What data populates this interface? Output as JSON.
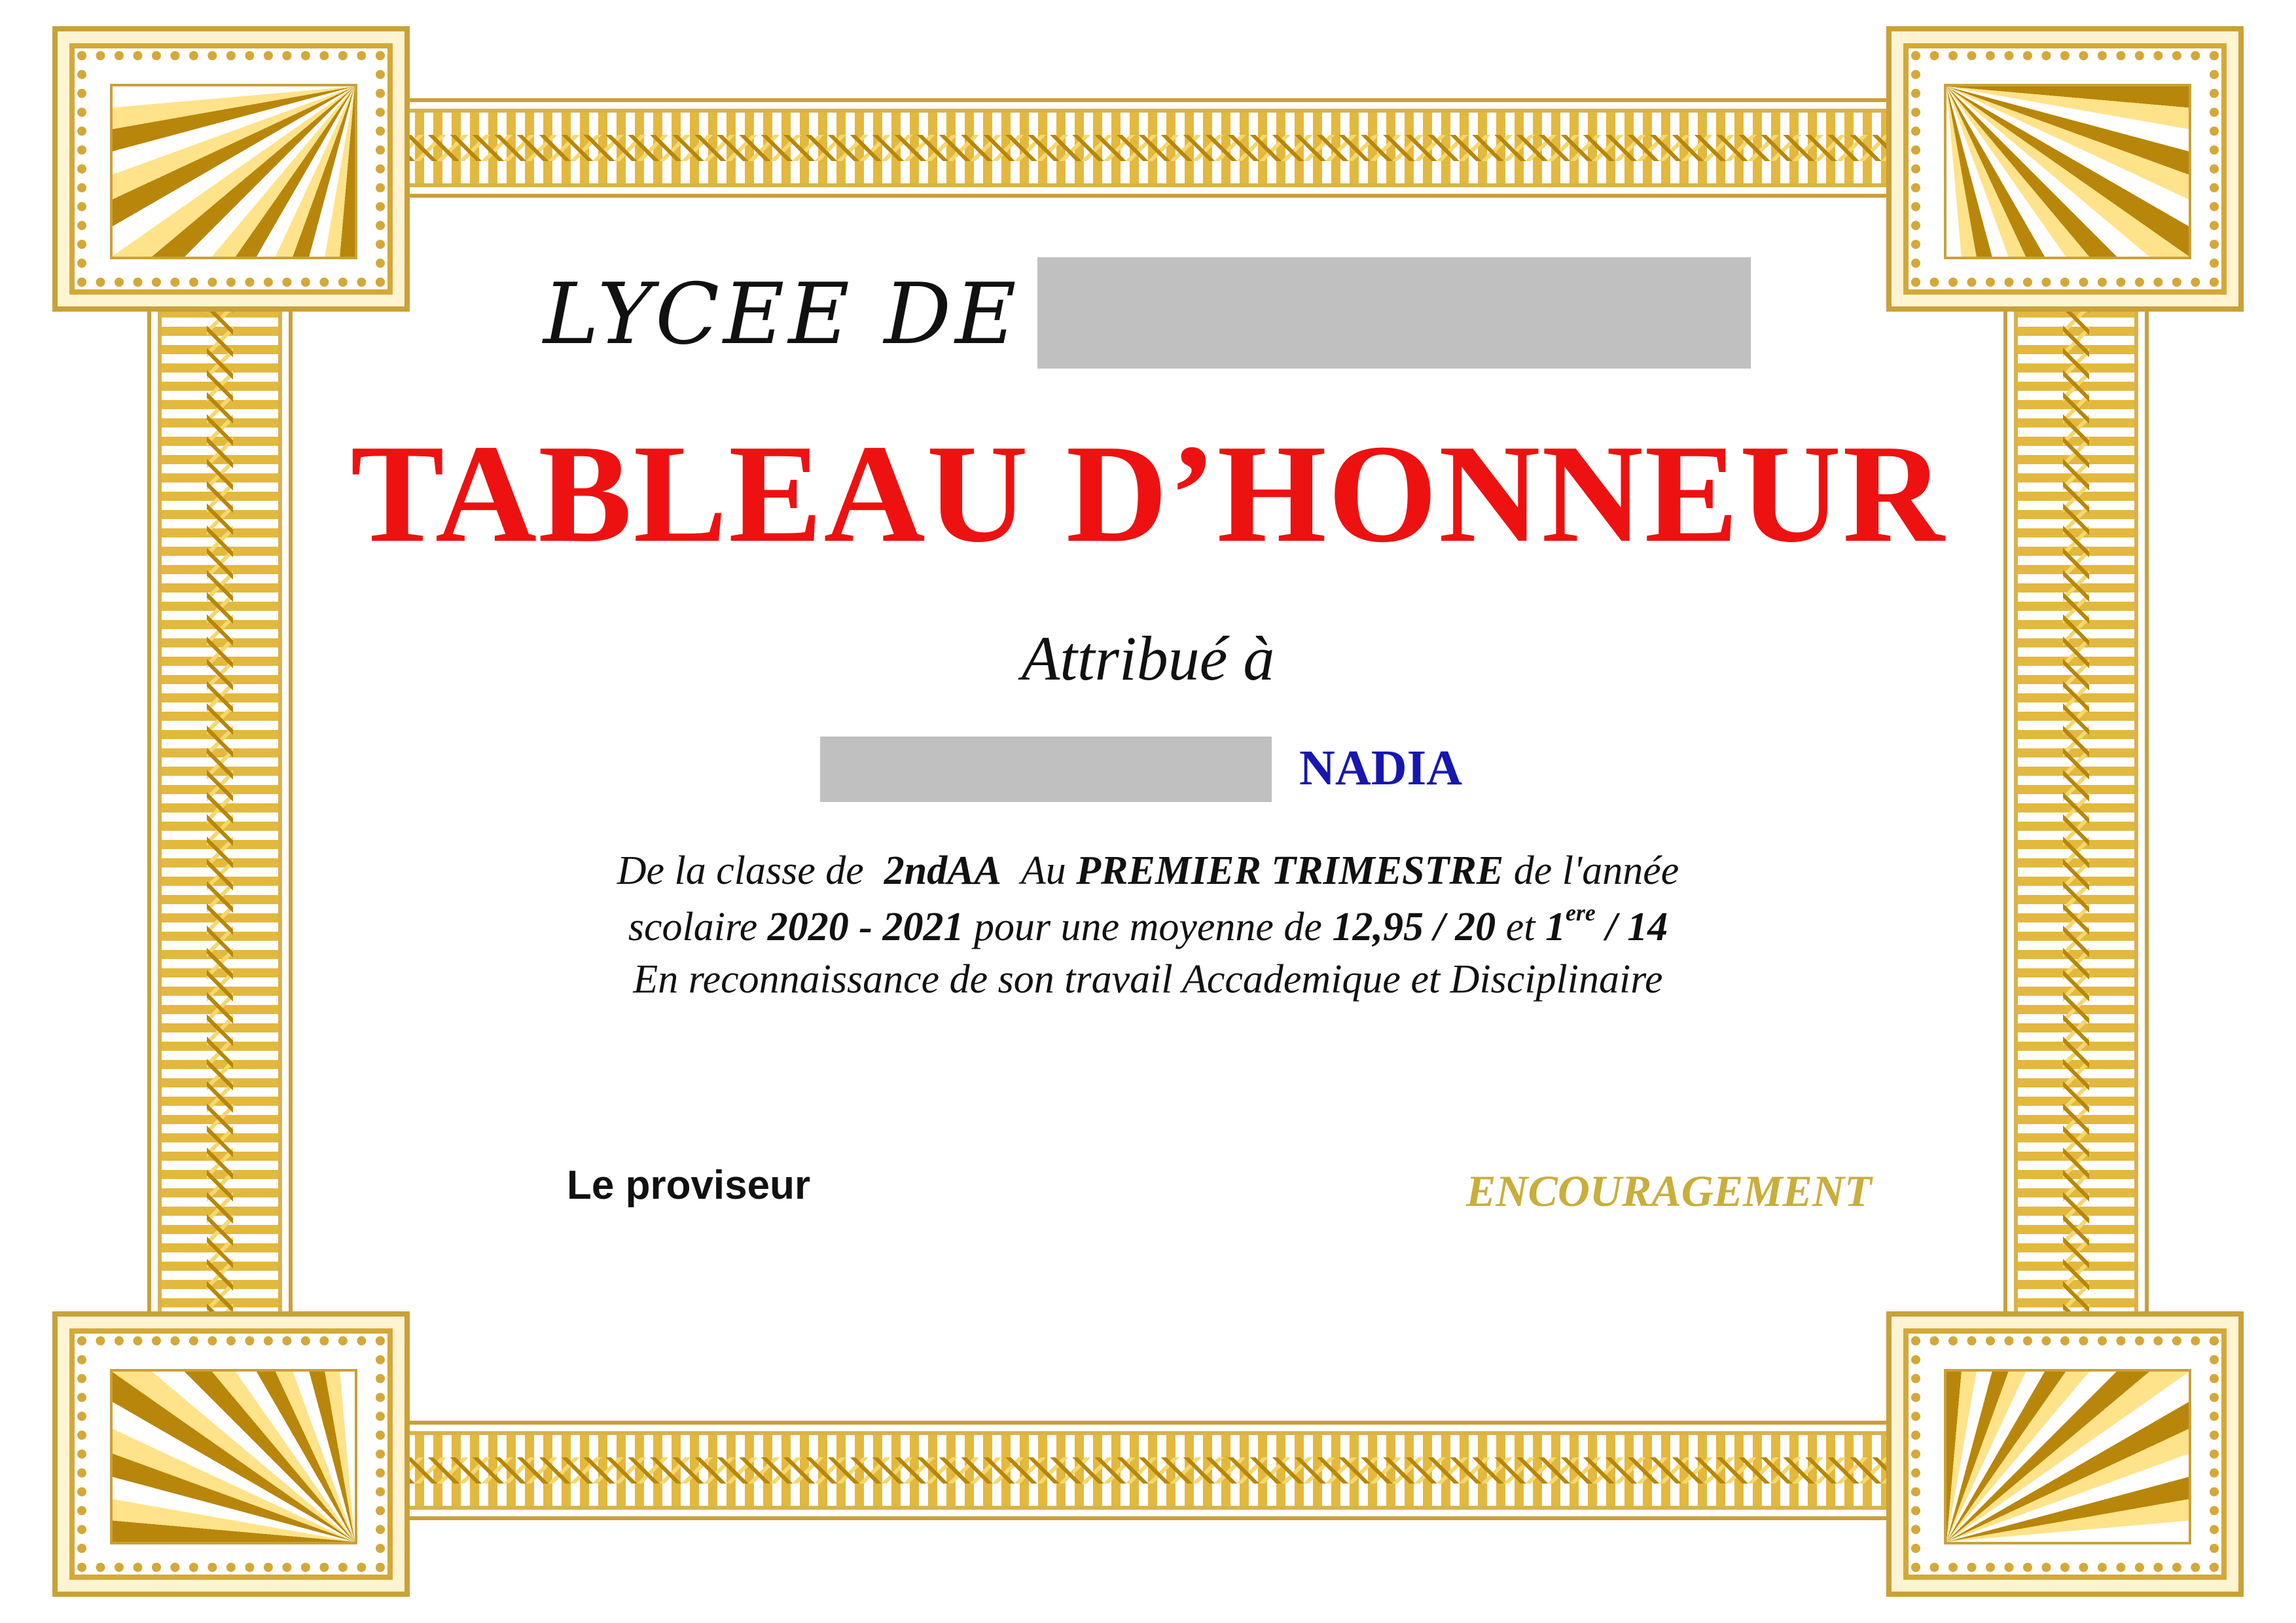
{
  "certificate": {
    "school_prefix": "LYCEE DE",
    "title": "TABLEAU D’HONNEUR",
    "awarded_to": "Attribué à",
    "student_firstname": "NADIA",
    "line1": {
      "p1": "De la classe de  ",
      "class": "2ndAA",
      "p2": "  Au ",
      "term": "PREMIER TRIMESTRE",
      "p3": " de l'année"
    },
    "line2": {
      "p1": "scolaire ",
      "year": "2020 - 2021",
      "p2": " pour une moyenne de ",
      "average": "12,95 / 20",
      "p3": " et ",
      "rank": "1",
      "rank_suffix": "ere",
      "rank_total": " / 14"
    },
    "line3": "En reconnaissance de son travail Accademique et Disciplinaire",
    "signatory": "Le proviseur",
    "mention": "ENCOURAGEMENT"
  },
  "colors": {
    "title": "#ee1111",
    "firstname": "#1717b0",
    "mention": "#c9ae3c",
    "gold": "#c9a13a",
    "redaction": "#c0c0c0"
  }
}
